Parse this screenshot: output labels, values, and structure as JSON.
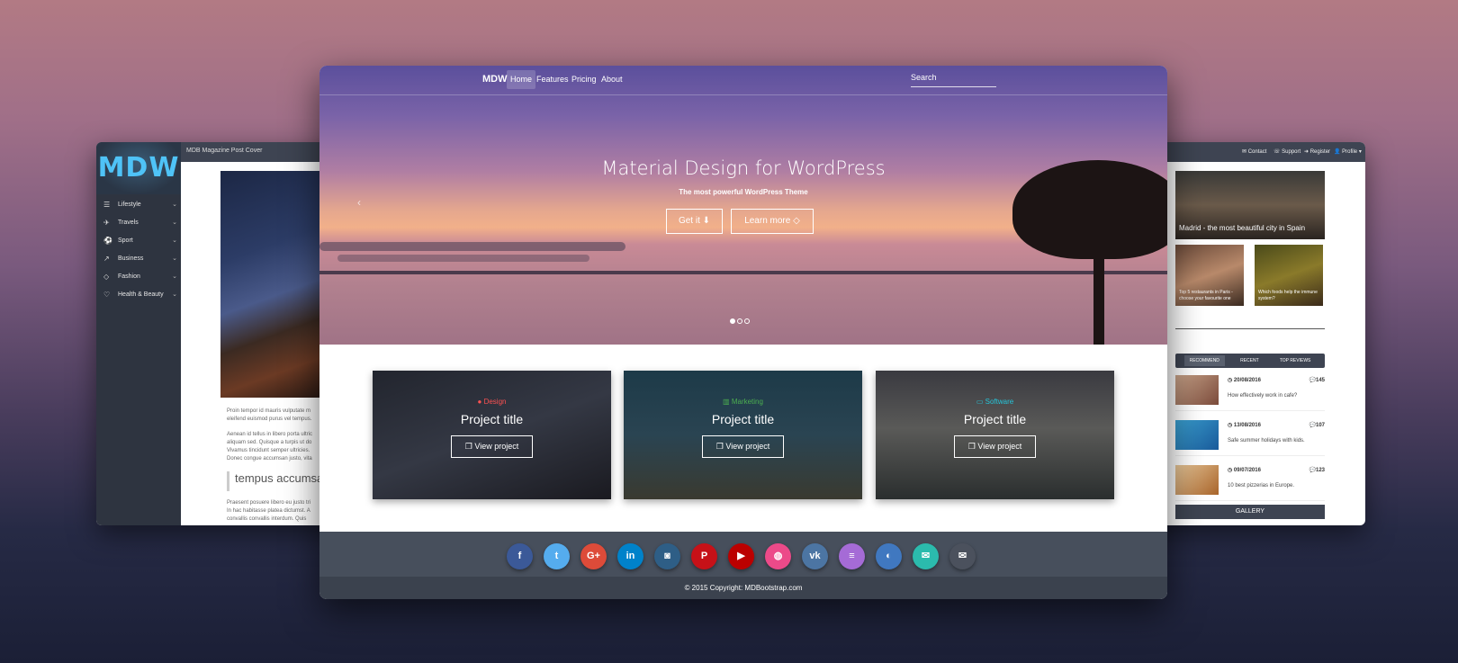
{
  "left_window": {
    "logo": "MDW",
    "topbar_title": "MDB Magazine Post Cover",
    "nav": [
      {
        "label": "Lifestyle",
        "icon": "list-icon"
      },
      {
        "label": "Travels",
        "icon": "plane-icon"
      },
      {
        "label": "Sport",
        "icon": "ball-icon"
      },
      {
        "label": "Business",
        "icon": "chart-icon"
      },
      {
        "label": "Fashion",
        "icon": "diamond-icon"
      },
      {
        "label": "Health & Beauty",
        "icon": "heart-icon"
      }
    ],
    "text_lines": [
      "Proin tempor id mauris vulputate m",
      "eleifend euismod purus vel tempus.",
      "Aenean id tellus in libero porta ultric",
      "aliquam sed. Quisque a turpis ut do",
      "Vivamus tincidunt semper ultricies.",
      "Donec congue accumsan justo, vita",
      "Praesent posuere libero eu justo tri",
      "In hac habitasse platea dictumst. A",
      "convallis convallis interdum. Quis"
    ],
    "quote": "tempus accumsa"
  },
  "right_window": {
    "top_links": [
      "Contact",
      "Support",
      "Register",
      "Profile"
    ],
    "big_caption": "Madrid - the most beautiful city in Spain",
    "small_captions": [
      "Top 5 restaurants in Paris - choose your favourite one",
      "Which foods help the immune system?"
    ],
    "tabs": [
      "RECOMMEND",
      "RECENT",
      "TOP REVIEWS"
    ],
    "items": [
      {
        "date": "20/08/2016",
        "count": "145",
        "desc": "How effectively work in cafe?"
      },
      {
        "date": "13/08/2016",
        "count": "107",
        "desc": "Safe summer holidays with kids."
      },
      {
        "date": "09/07/2016",
        "count": "123",
        "desc": "10 best pizzerias in Europe."
      }
    ],
    "gallery": "GALLERY"
  },
  "main_window": {
    "brand": "MDW",
    "nav": [
      "Home",
      "Features",
      "Pricing",
      "About"
    ],
    "active_nav": "Home",
    "search_placeholder": "Search",
    "hero_title": "Material Design for WordPress",
    "hero_subtitle": "The most powerful WordPress Theme",
    "btn_get": "Get it",
    "btn_learn": "Learn more",
    "carousel_active": 1,
    "cards": [
      {
        "tag": "Design",
        "tag_color": "#ff5252",
        "title": "Project title",
        "button": "View project",
        "icon": "palette-icon"
      },
      {
        "tag": "Marketing",
        "tag_color": "#4caf50",
        "title": "Project title",
        "button": "View project",
        "icon": "bar-chart-icon"
      },
      {
        "tag": "Software",
        "tag_color": "#26c6da",
        "title": "Project title",
        "button": "View project",
        "icon": "monitor-icon"
      }
    ],
    "social": [
      {
        "name": "facebook-icon",
        "glyph": "f",
        "color": "#3b5998"
      },
      {
        "name": "twitter-icon",
        "glyph": "t",
        "color": "#55acee"
      },
      {
        "name": "google-plus-icon",
        "glyph": "G+",
        "color": "#dd4b39"
      },
      {
        "name": "linkedin-icon",
        "glyph": "in",
        "color": "#0082ca"
      },
      {
        "name": "instagram-icon",
        "glyph": "◙",
        "color": "#2e5e86"
      },
      {
        "name": "pinterest-icon",
        "glyph": "P",
        "color": "#c61118"
      },
      {
        "name": "youtube-icon",
        "glyph": "▶",
        "color": "#bb0000"
      },
      {
        "name": "dribbble-icon",
        "glyph": "◍",
        "color": "#ec4a89"
      },
      {
        "name": "vk-icon",
        "glyph": "vk",
        "color": "#4c75a3"
      },
      {
        "name": "stackoverflow-icon",
        "glyph": "≡",
        "color": "#a56bd6"
      },
      {
        "name": "github-icon",
        "glyph": "◐",
        "color": "#4078c0"
      },
      {
        "name": "comments-icon",
        "glyph": "✉",
        "color": "#2bbbad"
      },
      {
        "name": "envelope-icon",
        "glyph": "✉",
        "color": "#4b515d"
      }
    ],
    "copyright_prefix": "© 2015 Copyright:",
    "copyright_link": "MDBootstrap.com"
  }
}
